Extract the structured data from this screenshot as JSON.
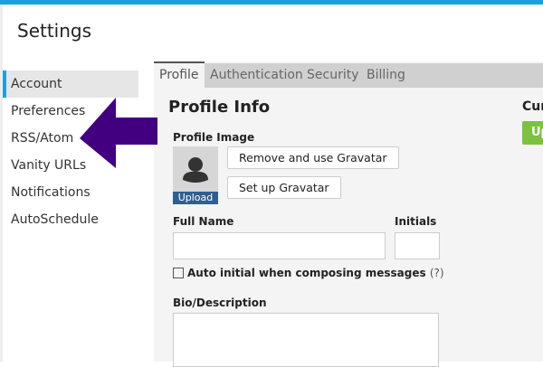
{
  "header": {
    "title": "Settings"
  },
  "sidebar": {
    "items": [
      {
        "label": "Account",
        "active": true
      },
      {
        "label": "Preferences"
      },
      {
        "label": "RSS/Atom"
      },
      {
        "label": "Vanity URLs"
      },
      {
        "label": "Notifications"
      },
      {
        "label": "AutoSchedule"
      }
    ]
  },
  "tabs": [
    {
      "label": "Profile",
      "active": true
    },
    {
      "label": "Authentication"
    },
    {
      "label": "Security"
    },
    {
      "label": "Billing"
    }
  ],
  "profile": {
    "heading": "Profile Info",
    "image_label": "Profile Image",
    "upload": "Upload",
    "remove_gravatar": "Remove and use Gravatar",
    "setup_gravatar": "Set up Gravatar",
    "full_name_label": "Full Name",
    "full_name_value": "",
    "initials_label": "Initials",
    "initials_value": "",
    "auto_initial_label": "Auto initial when composing messages",
    "help": "(?)",
    "auto_initial_checked": false,
    "bio_label": "Bio/Description",
    "bio_value": ""
  },
  "right": {
    "heading_partial": "Cur",
    "button_partial": "Up"
  },
  "colors": {
    "accent": "#1ba1e2",
    "arrow": "#420080",
    "green": "#7dc142",
    "upload": "#2e5f93"
  }
}
